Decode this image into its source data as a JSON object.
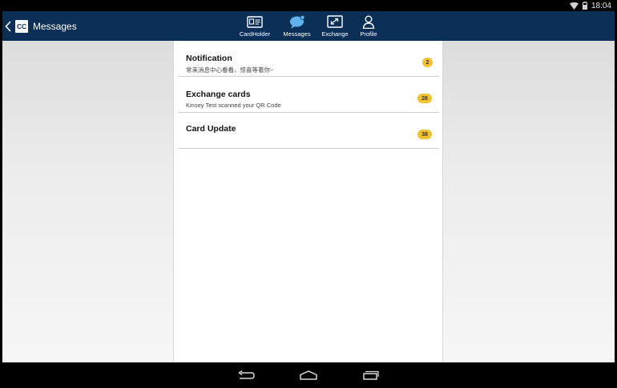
{
  "status_bar": {
    "time": "18:04",
    "icons": [
      "wifi-icon",
      "battery-icon"
    ]
  },
  "app_bar": {
    "logo_text": "CC",
    "title": "Messages",
    "background_color": "#0b2f56"
  },
  "nav_tabs": [
    {
      "label": "CardHolder",
      "icon": "id-card-icon",
      "active": false
    },
    {
      "label": "Messages",
      "icon": "chat-bubble-icon",
      "active": true
    },
    {
      "label": "Exchange",
      "icon": "exchange-icon",
      "active": false
    },
    {
      "label": "Profile",
      "icon": "person-icon",
      "active": false
    }
  ],
  "messages": [
    {
      "title": "Notification",
      "subtitle": "常来消息中心看看，惊喜等着你~",
      "badge": "2"
    },
    {
      "title": "Exchange cards",
      "subtitle": "Kinsey Test scanned your QR Code",
      "badge": "26"
    },
    {
      "title": "Card Update",
      "subtitle": "",
      "badge": "38"
    }
  ],
  "badge_color": "#f2c12e",
  "system_nav": [
    "back-icon",
    "home-icon",
    "recent-apps-icon"
  ]
}
